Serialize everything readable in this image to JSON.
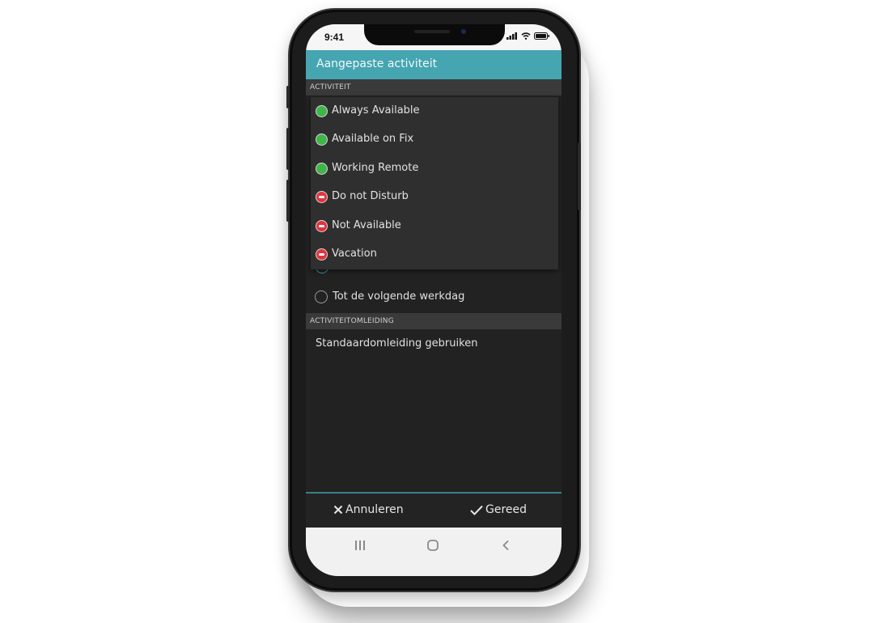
{
  "status_bar": {
    "time": "9:41",
    "icons": [
      "signal-icon",
      "wifi-icon",
      "battery-icon"
    ]
  },
  "header": {
    "title": "Aangepaste activiteit"
  },
  "sections": {
    "activity": "ACTIVITEIT",
    "redirect": "ACTIVITEITOMLEIDING"
  },
  "dropdown": {
    "items": [
      {
        "label": "Always Available",
        "status": "available",
        "color": "#3fb54a",
        "icon": "green-dot-icon"
      },
      {
        "label": "Available on Fix",
        "status": "available",
        "color": "#3fb54a",
        "icon": "green-dot-icon"
      },
      {
        "label": "Working Remote",
        "status": "available",
        "color": "#3fb54a",
        "icon": "green-dot-icon"
      },
      {
        "label": "Do not Disturb",
        "status": "unavailable",
        "color": "#e3333c",
        "icon": "no-entry-icon"
      },
      {
        "label": "Not Available",
        "status": "unavailable",
        "color": "#e3333c",
        "icon": "no-entry-icon"
      },
      {
        "label": "Vacation",
        "status": "unavailable",
        "color": "#e3333c",
        "icon": "no-entry-icon"
      }
    ]
  },
  "duration_options": [
    {
      "label": "Tot de volgende werkdag",
      "selected": false
    }
  ],
  "redirect": {
    "value": "Standaardomleiding gebruiken"
  },
  "actions": {
    "cancel": "Annuleren",
    "done": "Gereed"
  },
  "nav": [
    "recent-apps-icon",
    "home-icon",
    "back-icon"
  ],
  "colors": {
    "accent": "#45a5b1",
    "available": "#3fb54a",
    "unavailable": "#e3333c"
  }
}
